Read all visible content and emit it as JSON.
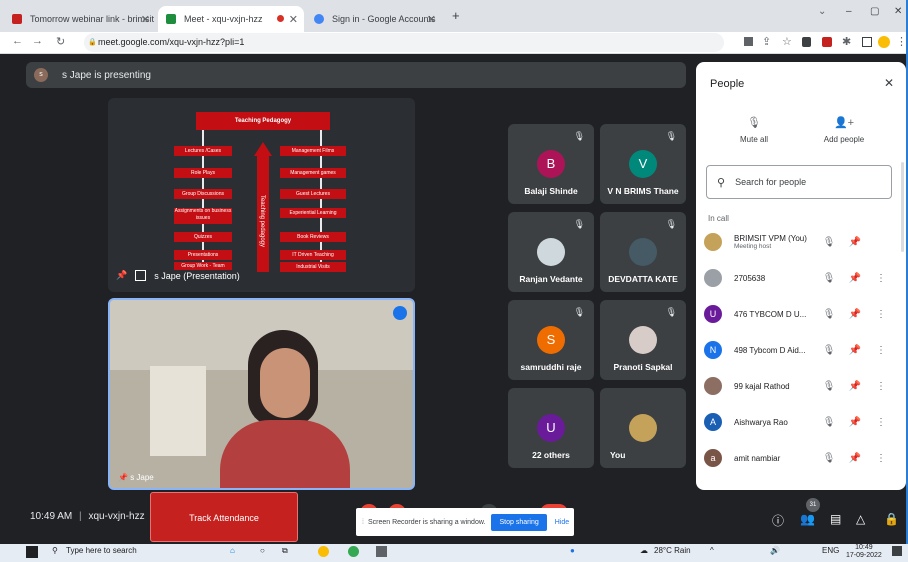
{
  "browser": {
    "tabs": [
      {
        "title": "Tomorrow webinar link - brimsit",
        "icon_color": "#c5221f"
      },
      {
        "title": "Meet - xqu-vxjn-hzz",
        "icon_color": "#1e8e3e"
      },
      {
        "title": "Sign in - Google Accounts",
        "icon_color": "#4285f4"
      }
    ],
    "url": "meet.google.com/xqu-vxjn-hzz?pli=1",
    "new_tab": "+"
  },
  "meet": {
    "presenting_banner": "s Jape is presenting",
    "presenter_initial": "s",
    "slide": {
      "title": "Teaching Pedagogy",
      "vertical_label": "Teaching pedagogy",
      "left_items": [
        "Lectures /Cases",
        "Role Plays",
        "Group Discussions",
        "Assignments on business issues",
        "Quizzes",
        "Presentations",
        "Group Work - Team"
      ],
      "right_items": [
        "Management Films",
        "Management games",
        "Guest Lectures",
        "Experiential Learning",
        "Book Reviews",
        "IT Driven Teaching",
        "Industrial Visits"
      ],
      "caption": "s Jape (Presentation)"
    },
    "video_caption": "s Jape",
    "tiles": [
      {
        "name": "Balaji Shinde",
        "initial": "B",
        "color": "#ad1457"
      },
      {
        "name": "V N BRIMS Thane",
        "initial": "V",
        "color": "#00897b"
      },
      {
        "name": "Ranjan Vedante",
        "initial": "",
        "color": "#cfd8dc"
      },
      {
        "name": "DEVDATTA KATE",
        "initial": "",
        "color": "#455a64"
      },
      {
        "name": "samruddhi raje",
        "initial": "S",
        "color": "#ef6c00"
      },
      {
        "name": "Pranoti Sapkal",
        "initial": "",
        "color": "#d7ccc8"
      },
      {
        "name": "22 others",
        "initial": "U",
        "color": "#6a1b9a"
      },
      {
        "name": "You",
        "initial": "",
        "color": "#c5a25a"
      }
    ],
    "time": "10:49 AM",
    "meeting_code": "xqu-vxjn-hzz",
    "track_button": "Track Attendance",
    "people_badge": "31",
    "recorder": {
      "text": "Screen Recorder is sharing a window.",
      "stop": "Stop sharing",
      "hide": "Hide"
    }
  },
  "people": {
    "title": "People",
    "mute_all": "Mute all",
    "add_people": "Add people",
    "search_placeholder": "Search for people",
    "section": "In call",
    "members": [
      {
        "name": "BRIMSIT VPM (You)",
        "sub": "Meeting host",
        "initial": "",
        "color": "#c5a25a"
      },
      {
        "name": "2705638",
        "sub": "",
        "initial": "",
        "color": "#9aa0a6"
      },
      {
        "name": "476 TYBCOM D U...",
        "sub": "",
        "initial": "U",
        "color": "#6a1b9a"
      },
      {
        "name": "498 Tybcom D Aid...",
        "sub": "",
        "initial": "N",
        "color": "#1a73e8"
      },
      {
        "name": "99 kajal Rathod",
        "sub": "",
        "initial": "",
        "color": "#8d6e63"
      },
      {
        "name": "Aishwarya Rao",
        "sub": "",
        "initial": "A",
        "color": "#1a5fb4"
      },
      {
        "name": "amit nambiar",
        "sub": "",
        "initial": "a",
        "color": "#795548"
      }
    ]
  },
  "taskbar": {
    "search": "Type here to search",
    "weather": "28°C Rain",
    "lang": "ENG",
    "time": "10:49",
    "date": "17-09-2022"
  }
}
